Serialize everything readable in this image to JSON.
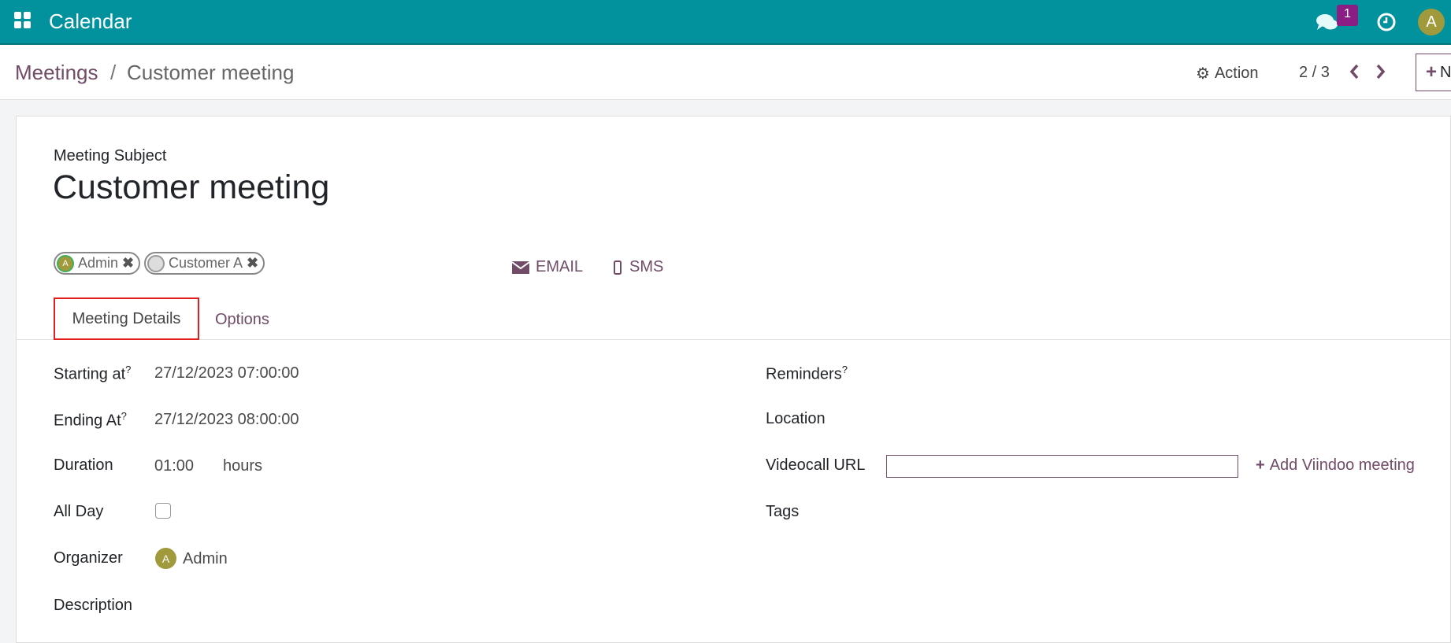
{
  "topbar": {
    "app_title": "Calendar",
    "messages_badge": "1",
    "avatar_letter": "A",
    "accent": "#01929e"
  },
  "breadcrumb": {
    "parent": "Meetings",
    "separator": "/",
    "current": "Customer meeting"
  },
  "controls": {
    "action_label": "Action",
    "pager": "2 / 3",
    "new_label": "N"
  },
  "form": {
    "subject_label": "Meeting Subject",
    "title": "Customer meeting",
    "attendees": [
      {
        "initial": "A",
        "name": "Admin"
      },
      {
        "name": "Customer A"
      }
    ],
    "email_label": "EMAIL",
    "sms_label": "SMS",
    "tabs": [
      "Meeting Details",
      "Options"
    ],
    "left": {
      "starting_label": "Starting at",
      "starting_value": "27/12/2023 07:00:00",
      "ending_label": "Ending At",
      "ending_value": "27/12/2023 08:00:00",
      "duration_label": "Duration",
      "duration_value": "01:00",
      "duration_unit": "hours",
      "allday_label": "All Day",
      "organizer_label": "Organizer",
      "organizer_initial": "A",
      "organizer_value": "Admin",
      "description_label": "Description"
    },
    "right": {
      "reminders_label": "Reminders",
      "location_label": "Location",
      "videocall_label": "Videocall URL",
      "videocall_value": "",
      "add_meeting_label": "Add Viindoo meeting",
      "tags_label": "Tags"
    },
    "help_mark": "?"
  }
}
